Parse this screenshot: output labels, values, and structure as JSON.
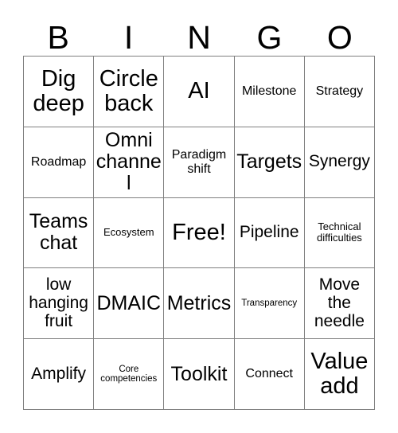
{
  "card": {
    "header_letters": [
      "B",
      "I",
      "N",
      "G",
      "O"
    ],
    "rows": [
      [
        {
          "text": "Dig deep",
          "size": "s-xl"
        },
        {
          "text": "Circle back",
          "size": "s-xl"
        },
        {
          "text": "AI",
          "size": "s-xl"
        },
        {
          "text": "Milestone",
          "size": "s-sm"
        },
        {
          "text": "Strategy",
          "size": "s-sm"
        }
      ],
      [
        {
          "text": "Roadmap",
          "size": "s-sm"
        },
        {
          "text": "Omni channel",
          "size": "s-lg"
        },
        {
          "text": "Paradigm shift",
          "size": "s-sm"
        },
        {
          "text": "Targets",
          "size": "s-lg"
        },
        {
          "text": "Synergy",
          "size": "s-md"
        }
      ],
      [
        {
          "text": "Teams chat",
          "size": "s-lg"
        },
        {
          "text": "Ecosystem",
          "size": "s-xs"
        },
        {
          "text": "Free!",
          "size": "s-xl"
        },
        {
          "text": "Pipeline",
          "size": "s-md"
        },
        {
          "text": "Technical difficulties",
          "size": "s-xs"
        }
      ],
      [
        {
          "text": "low hanging fruit",
          "size": "s-md"
        },
        {
          "text": "DMAIC",
          "size": "s-lg"
        },
        {
          "text": "Metrics",
          "size": "s-lg"
        },
        {
          "text": "Transparency",
          "size": "s-xxs"
        },
        {
          "text": "Move the needle",
          "size": "s-md"
        }
      ],
      [
        {
          "text": "Amplify",
          "size": "s-md"
        },
        {
          "text": "Core competencies",
          "size": "s-xxs"
        },
        {
          "text": "Toolkit",
          "size": "s-lg"
        },
        {
          "text": "Connect",
          "size": "s-sm"
        },
        {
          "text": "Value add",
          "size": "s-xl"
        }
      ]
    ]
  }
}
